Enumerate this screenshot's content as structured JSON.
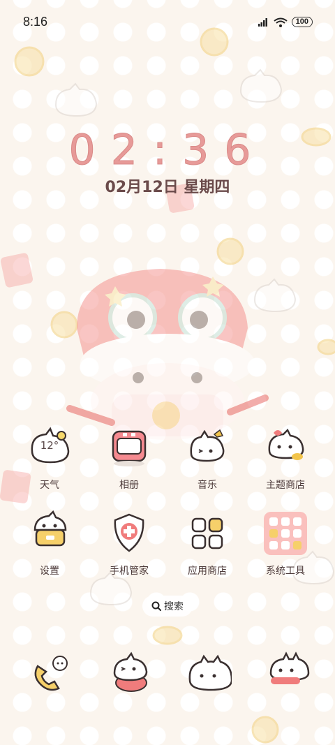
{
  "status_bar": {
    "time": "8:16",
    "battery": "100",
    "icons": [
      "signal-icon",
      "alarm-icon",
      "wifi-icon",
      "battery-icon"
    ]
  },
  "clock": {
    "time": "02:36",
    "date": "02月12日 星期四"
  },
  "apps": [
    {
      "name": "天气",
      "icon": "weather-cloud-icon",
      "badge": "12°"
    },
    {
      "name": "相册",
      "icon": "gallery-camera-icon"
    },
    {
      "name": "音乐",
      "icon": "music-cat-icon"
    },
    {
      "name": "主题商店",
      "icon": "theme-store-cat-icon"
    },
    {
      "name": "设置",
      "icon": "settings-cat-icon"
    },
    {
      "name": "手机管家",
      "icon": "security-shield-icon"
    },
    {
      "name": "应用商店",
      "icon": "app-store-grid-icon"
    },
    {
      "name": "系统工具",
      "icon": "system-tools-folder-icon"
    }
  ],
  "search": {
    "label": "搜索",
    "icon": "search-icon"
  },
  "dock": [
    {
      "icon": "phone-icon"
    },
    {
      "icon": "messages-icon"
    },
    {
      "icon": "browser-icon"
    },
    {
      "icon": "camera-icon"
    }
  ],
  "colors": {
    "clock": "#e79a98",
    "accent_red": "#f07c7c",
    "accent_yellow": "#f2c44b"
  }
}
